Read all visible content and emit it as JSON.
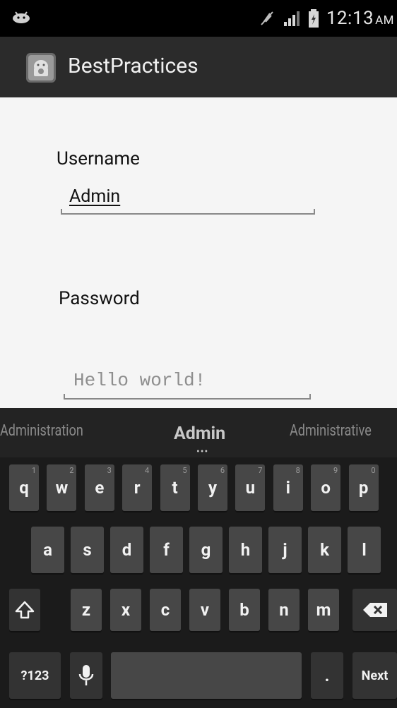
{
  "status_bar": {
    "time": "12:13",
    "ampm": "AM"
  },
  "app": {
    "title": "BestPractices"
  },
  "form": {
    "username_label": "Username",
    "username_value": "Admin",
    "password_label": "Password",
    "password_hint": "Hello world!"
  },
  "keyboard": {
    "suggestions": [
      "Administration",
      "Admin",
      "Administrative"
    ],
    "rows": [
      [
        {
          "k": "q",
          "h": "1"
        },
        {
          "k": "w",
          "h": "2"
        },
        {
          "k": "e",
          "h": "3"
        },
        {
          "k": "r",
          "h": "4"
        },
        {
          "k": "t",
          "h": "5"
        },
        {
          "k": "y",
          "h": "6"
        },
        {
          "k": "u",
          "h": "7"
        },
        {
          "k": "i",
          "h": "8"
        },
        {
          "k": "o",
          "h": "9"
        },
        {
          "k": "p",
          "h": "0"
        }
      ],
      [
        {
          "k": "a"
        },
        {
          "k": "s"
        },
        {
          "k": "d"
        },
        {
          "k": "f"
        },
        {
          "k": "g"
        },
        {
          "k": "h"
        },
        {
          "k": "j"
        },
        {
          "k": "k"
        },
        {
          "k": "l"
        }
      ],
      [
        {
          "k": "z"
        },
        {
          "k": "x"
        },
        {
          "k": "c"
        },
        {
          "k": "v"
        },
        {
          "k": "b"
        },
        {
          "k": "n"
        },
        {
          "k": "m"
        }
      ]
    ],
    "symbols_label": "?123",
    "period_label": ".",
    "next_label": "Next"
  }
}
